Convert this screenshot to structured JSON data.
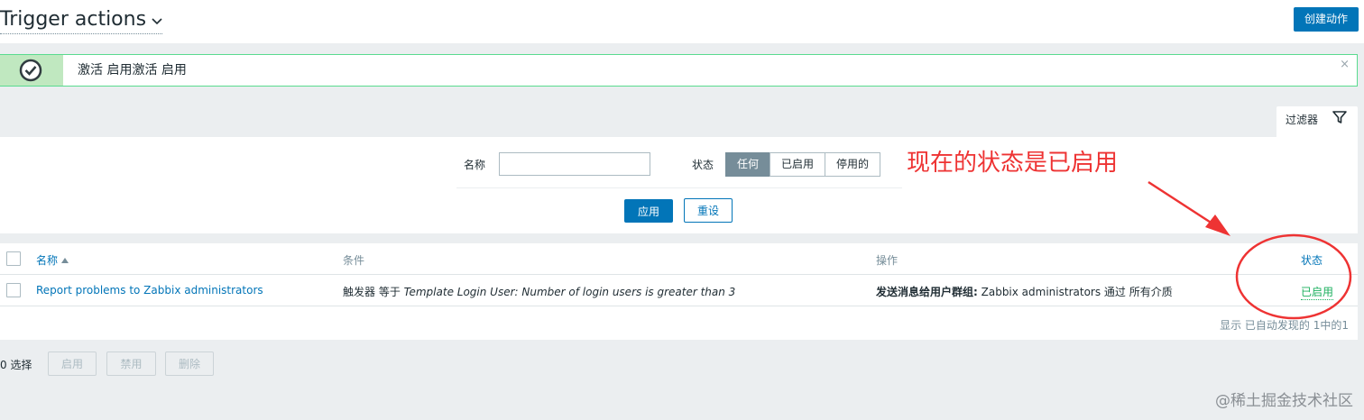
{
  "header": {
    "title": "Trigger actions",
    "create_label": "创建动作"
  },
  "message": {
    "text": "激活 启用激活 启用",
    "close": "×"
  },
  "filter": {
    "tab_label": "过滤器",
    "name_label": "名称",
    "name_value": "",
    "status_label": "状态",
    "status_options": [
      "任何",
      "已启用",
      "停用的"
    ],
    "status_selected": "任何",
    "apply_label": "应用",
    "reset_label": "重设"
  },
  "annotation": {
    "text": "现在的状态是已启用",
    "color": "#ee3333"
  },
  "table": {
    "columns": {
      "name": "名称",
      "conditions": "条件",
      "operations": "操作",
      "status": "状态"
    },
    "rows": [
      {
        "name": "Report problems to Zabbix administrators",
        "condition_prefix": "触发器 等于 ",
        "condition_value": "Template Login User: Number of login users is greater than 3",
        "operation_label": "发送消息给用户群组:",
        "operation_value": " Zabbix administrators 通过 所有介质",
        "status": "已启用"
      }
    ],
    "stats": "显示 已自动发现的 1中的1"
  },
  "bottom": {
    "selected": "0 选择",
    "enable_label": "启用",
    "disable_label": "禁用",
    "delete_label": "删除"
  },
  "watermark": "@稀土掘金技术社区",
  "colors": {
    "primary": "#0275b8",
    "success": "#1aaf5d",
    "success_border": "#59db8f",
    "annotation": "#ee3333"
  }
}
